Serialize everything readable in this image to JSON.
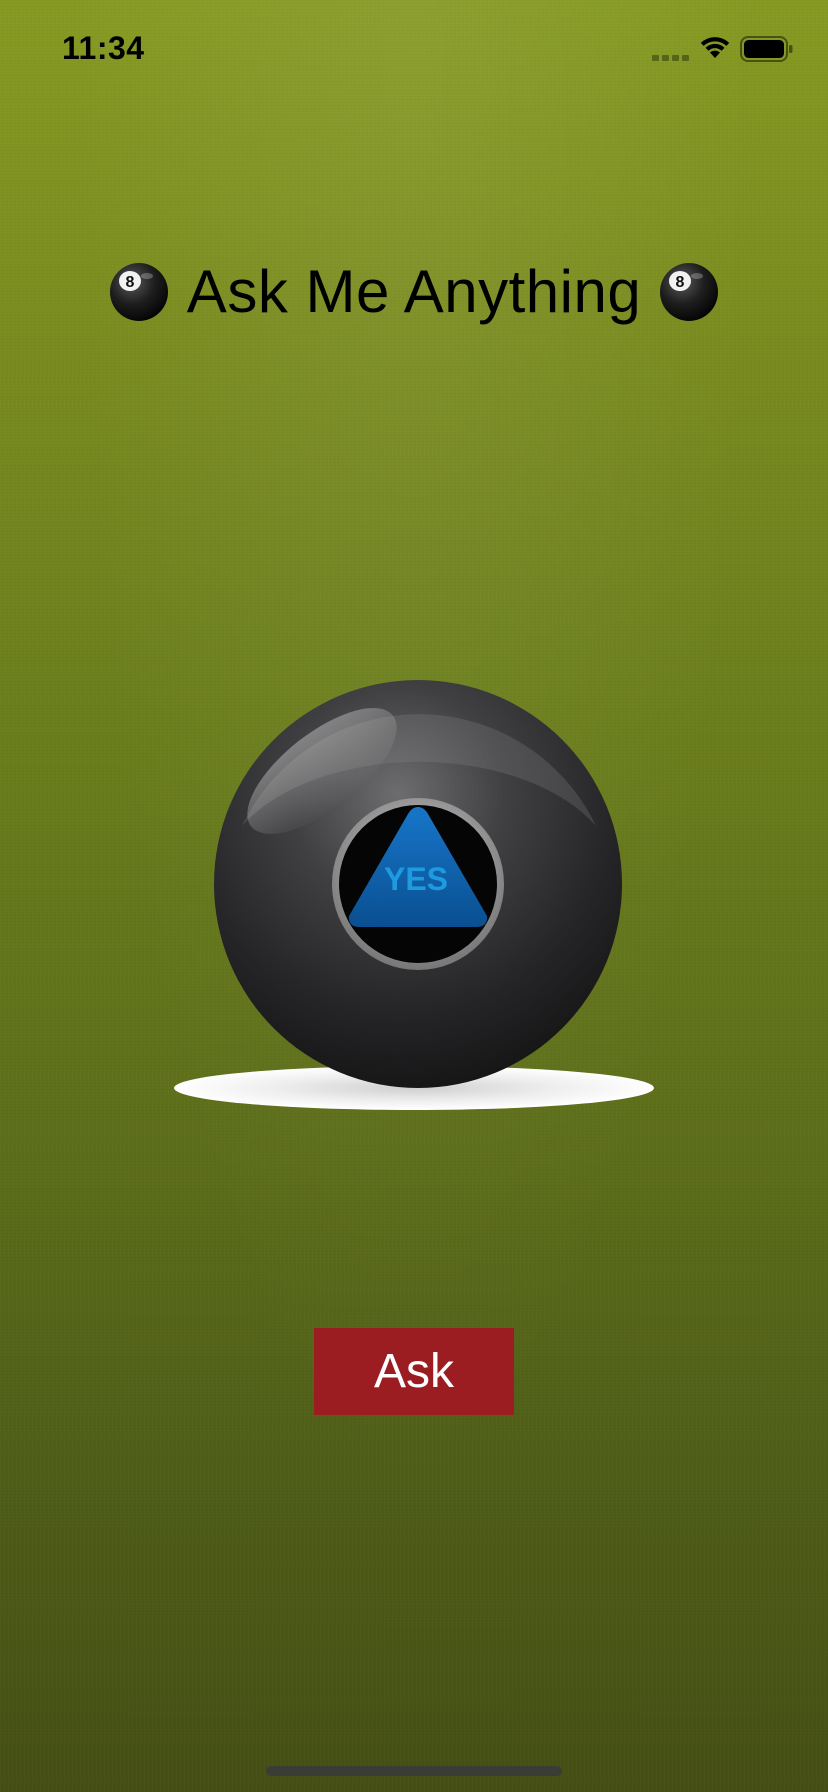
{
  "status_bar": {
    "time": "11:34",
    "icons": [
      "cellular-signal-icon",
      "wifi-icon",
      "battery-icon"
    ]
  },
  "title": {
    "text": "Ask Me Anything",
    "leading_icon": "eight-ball-icon",
    "trailing_icon": "eight-ball-icon"
  },
  "magic_ball": {
    "answer": "YES"
  },
  "ask_button": {
    "label": "Ask"
  },
  "colors": {
    "background_top": "#869a22",
    "background_bottom": "#454f15",
    "button": "#9b1d22",
    "answer_triangle": "#0b5fa8",
    "answer_text": "#1e9be0"
  }
}
